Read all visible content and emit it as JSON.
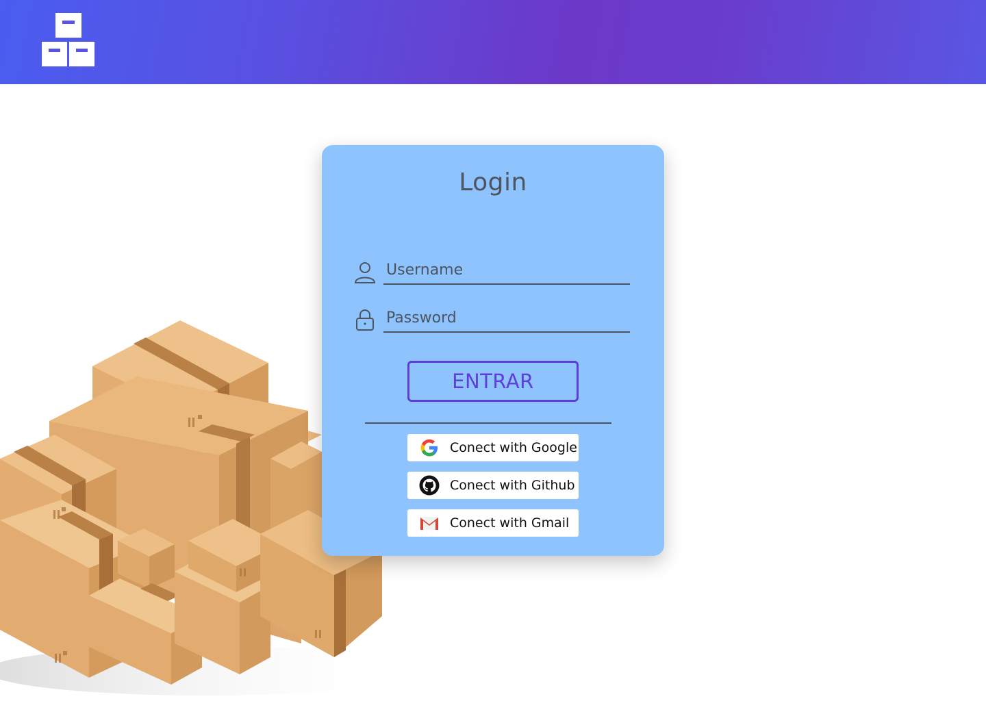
{
  "header": {
    "logo_icon": "boxes-logo-icon",
    "gradient": [
      "#4a5df0",
      "#6c38c8",
      "#5a56e4"
    ]
  },
  "illustration": {
    "icon": "cardboard-boxes-illustration"
  },
  "login": {
    "title": "Login",
    "username": {
      "placeholder": "Username",
      "icon": "user-icon"
    },
    "password": {
      "placeholder": "Password",
      "icon": "lock-icon"
    },
    "submit_label": "ENTRAR",
    "social": [
      {
        "label": "Conect with Google",
        "icon": "google-icon"
      },
      {
        "label": "Conect with Github",
        "icon": "github-icon"
      },
      {
        "label": "Conect with Gmail",
        "icon": "gmail-icon"
      }
    ]
  },
  "colors": {
    "card": "#8ec3fd",
    "accent": "#5b3fd6",
    "text": "#4b5461"
  }
}
